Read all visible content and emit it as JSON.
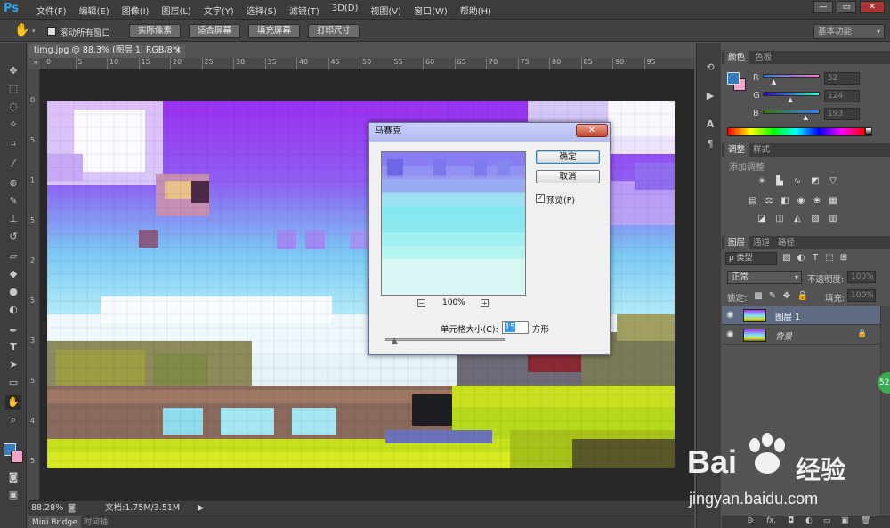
{
  "app": {
    "logo": "Ps"
  },
  "menu": [
    "文件(F)",
    "编辑(E)",
    "图像(I)",
    "图层(L)",
    "文字(Y)",
    "选择(S)",
    "滤镜(T)",
    "3D(D)",
    "视图(V)",
    "窗口(W)",
    "帮助(H)"
  ],
  "window_controls": {
    "minimize": "—",
    "restore": "▭",
    "close": "✕"
  },
  "options": {
    "scroll_all": "滚动所有窗口",
    "actual_pixels": "实际像素",
    "fit_screen": "适合屏幕",
    "fill_screen": "填充屏幕",
    "print_size": "打印尺寸",
    "workspace": "基本功能"
  },
  "document": {
    "tab_title": "timg.jpg @ 88.3% (图层 1, RGB/8*) *",
    "tab_close": "×",
    "ruler_top_ticks": [
      "0",
      "5",
      "10",
      "15",
      "20",
      "25",
      "30",
      "35",
      "40",
      "45",
      "50",
      "55",
      "60",
      "65",
      "70",
      "75",
      "80",
      "85",
      "90",
      "95"
    ],
    "ruler_left_ticks": [
      "0",
      "5",
      "1",
      "5",
      "2",
      "5",
      "3",
      "5",
      "4",
      "5"
    ],
    "zoom": "88.28%",
    "doc_info": "文档:1.75M/3.51M"
  },
  "bottom_tabs": [
    "Mini Bridge",
    "时间轴"
  ],
  "color_panel": {
    "tabs": [
      "颜色",
      "色板"
    ],
    "r_label": "R",
    "g_label": "G",
    "b_label": "B",
    "r_value": "52",
    "g_value": "124",
    "b_value": "193",
    "r_level": 0.2,
    "g_level": 0.49,
    "b_level": 0.76,
    "foreground": "#347cc1",
    "background": "#f2a3c9"
  },
  "adjust_panel": {
    "tabs": [
      "调整",
      "样式"
    ],
    "heading": "添加调整"
  },
  "layers_panel": {
    "tabs": [
      "图层",
      "通道",
      "路径"
    ],
    "filter_label": "ρ 类型",
    "blend_mode": "正常",
    "opacity_label": "不透明度:",
    "opacity_value": "100%",
    "lock_label": "锁定:",
    "fill_label": "填充:",
    "fill_value": "100%",
    "layers": [
      {
        "name": "图层 1",
        "selected": true
      },
      {
        "name": "背景",
        "selected": false,
        "locked": true
      }
    ],
    "badge": "52"
  },
  "dialog": {
    "title": "马赛克",
    "close": "✕",
    "ok": "确定",
    "cancel": "取消",
    "preview_label": "预览(P)",
    "preview_checked": true,
    "zoom_out": "−",
    "zoom_in": "+",
    "zoom_level": "100%",
    "cell_size_label": "单元格大小(C):",
    "cell_size_value": "15",
    "cell_size_unit": "方形",
    "cell_size_level": 0.05
  },
  "watermark": {
    "brand_a": "Bai",
    "brand_b": "经验",
    "url": "jingyan.baidu.com"
  },
  "icons": [
    "hand-icon",
    "move-icon",
    "marquee-icon",
    "lasso-icon",
    "magic-wand-icon",
    "crop-icon",
    "eyedropper-icon",
    "healing-icon",
    "brush-icon",
    "stamp-icon",
    "history-brush-icon",
    "eraser-icon",
    "paint-bucket-icon",
    "blur-icon",
    "dodge-icon",
    "pen-icon",
    "type-icon",
    "path-select-icon",
    "shape-icon",
    "zoom-icon"
  ]
}
